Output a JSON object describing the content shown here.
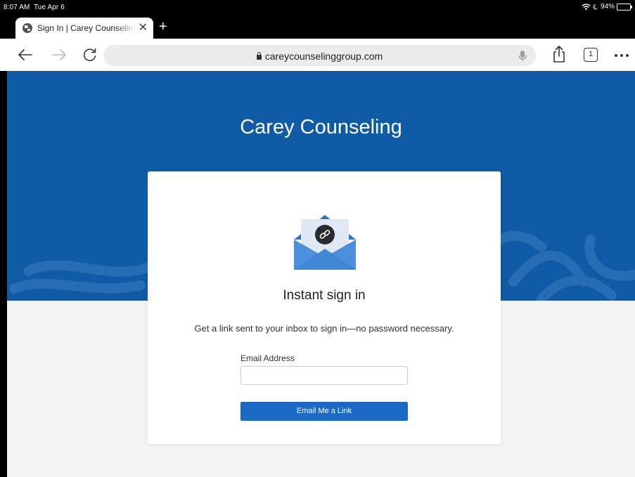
{
  "status_bar": {
    "time": "8:07 AM",
    "date": "Tue Apr 6",
    "battery_percent": "94%",
    "battery_level": 0.94
  },
  "browser": {
    "tab": {
      "title": "Sign In | Carey Counseling Group",
      "close_glyph": "✕",
      "favicon": "globe-icon"
    },
    "new_tab_glyph": "+",
    "url": "careycounselinggroup.com",
    "tab_count": "1",
    "icons": [
      "back-arrow-icon",
      "forward-arrow-icon",
      "reload-icon",
      "lock-icon",
      "microphone-icon",
      "share-icon",
      "tabs-icon",
      "more-icon"
    ]
  },
  "page": {
    "hero_title": "Carey Counseling",
    "card": {
      "title": "Instant sign in",
      "description": "Get a link sent to your inbox to sign in—no password necessary.",
      "email_label": "Email Address",
      "email_value": "",
      "button_label": "Email Me a Link",
      "illustration": "envelope-link-icon"
    }
  },
  "colors": {
    "hero_blue": "#0f5ba6",
    "button_blue": "#1a69c4",
    "page_bg": "#f3f3f4",
    "envelope_blue": "#3d85d6"
  }
}
